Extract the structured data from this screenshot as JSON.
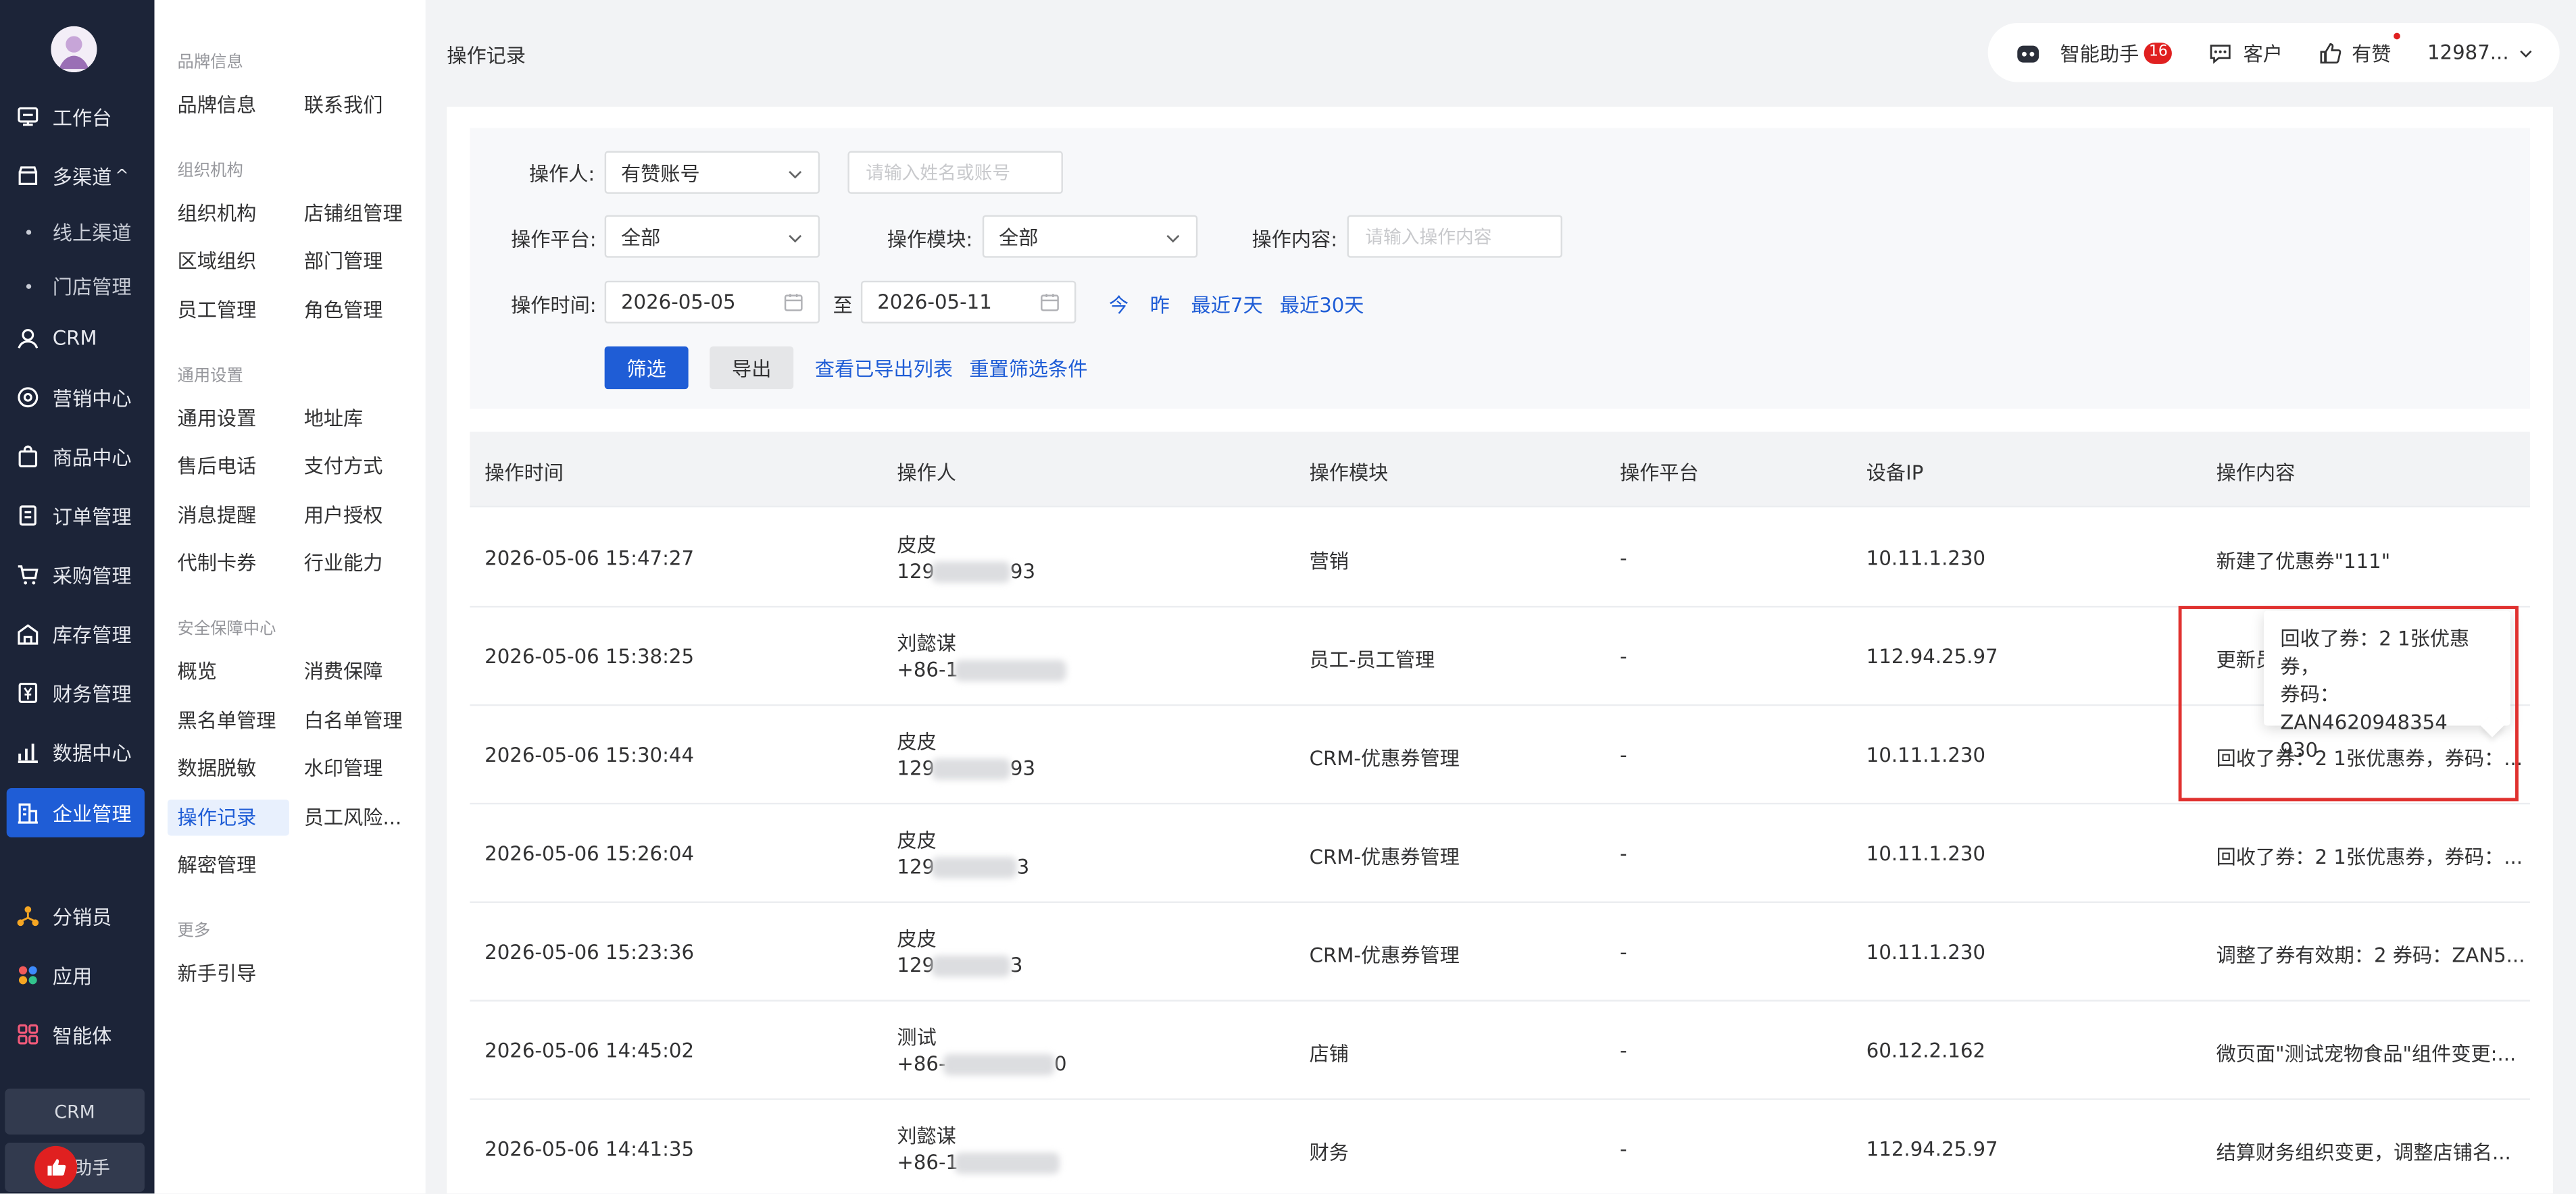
{
  "nav": {
    "items": [
      {
        "label": "工作台",
        "icon": "workbench-icon"
      },
      {
        "label": "多渠道",
        "icon": "store-icon",
        "suffix": "^"
      },
      {
        "label": "CRM",
        "icon": "user-icon"
      },
      {
        "label": "营销中心",
        "icon": "marketing-icon"
      },
      {
        "label": "商品中心",
        "icon": "bag-icon"
      },
      {
        "label": "订单管理",
        "icon": "order-icon"
      },
      {
        "label": "采购管理",
        "icon": "cart-icon"
      },
      {
        "label": "库存管理",
        "icon": "warehouse-icon"
      },
      {
        "label": "财务管理",
        "icon": "finance-icon"
      },
      {
        "label": "数据中心",
        "icon": "chart-icon"
      },
      {
        "label": "企业管理",
        "icon": "enterprise-icon"
      },
      {
        "label": "分销员",
        "icon": "distributor-icon"
      },
      {
        "label": "应用",
        "icon": "apps-icon"
      },
      {
        "label": "智能体",
        "icon": "agent-icon"
      }
    ],
    "sub_items": [
      "线上渠道",
      "门店管理"
    ],
    "crm_button": "CRM",
    "help_button": "助手"
  },
  "menu2": {
    "sections": [
      "品牌信息",
      "组织机构",
      "通用设置",
      "安全保障中心",
      "更多"
    ],
    "links": [
      "品牌信息",
      "联系我们",
      "组织机构",
      "店铺组管理",
      "区域组织",
      "部门管理",
      "员工管理",
      "角色管理",
      "通用设置",
      "地址库",
      "售后电话",
      "支付方式",
      "消息提醒",
      "用户授权",
      "代制卡券",
      "行业能力",
      "概览",
      "消费保障",
      "黑名单管理",
      "白名单管理",
      "数据脱敏",
      "水印管理",
      "操作记录",
      "员工风险...",
      "解密管理",
      "新手引导"
    ]
  },
  "header": {
    "page_title": "操作记录",
    "assistant": "智能助手",
    "assistant_badge": "16",
    "customer": "客户",
    "youzan": "有赞",
    "account": "12987..."
  },
  "filter": {
    "operator_label": "操作人:",
    "operator_type": "有赞账号",
    "operator_placeholder": "请输入姓名或账号",
    "platform_label": "操作平台:",
    "platform_value": "全部",
    "module_label": "操作模块:",
    "module_value": "全部",
    "content_label": "操作内容:",
    "content_placeholder": "请输入操作内容",
    "time_label": "操作时间:",
    "start_date": "2026-05-05",
    "to": "至",
    "end_date": "2026-05-11",
    "quick": [
      "今",
      "昨",
      "最近7天",
      "最近30天"
    ],
    "filter_button": "筛选",
    "export_button": "导出",
    "view_exports": "查看已导出列表",
    "reset": "重置筛选条件"
  },
  "table": {
    "columns": [
      "操作时间",
      "操作人",
      "操作模块",
      "操作平台",
      "设备IP",
      "操作内容"
    ],
    "rows": [
      {
        "time": "2026-05-06 15:47:27",
        "name": "皮皮",
        "account": "129",
        "account_tail": "93",
        "module": "营销",
        "platform": "-",
        "ip": "10.11.1.230",
        "content": "新建了优惠券\"111\""
      },
      {
        "time": "2026-05-06 15:38:25",
        "name": "刘懿谋",
        "account": "+86-1",
        "account_tail": "",
        "module": "员工-员工管理",
        "platform": "-",
        "ip": "112.94.25.97",
        "content": "更新员"
      },
      {
        "time": "2026-05-06 15:30:44",
        "name": "皮皮",
        "account": "129",
        "account_tail": "93",
        "module": "CRM-优惠券管理",
        "platform": "-",
        "ip": "10.11.1.230",
        "content": "回收了券：2 1张优惠券，券码：..."
      },
      {
        "time": "2026-05-06 15:26:04",
        "name": "皮皮",
        "account": "129",
        "account_tail": "3",
        "module": "CRM-优惠券管理",
        "platform": "-",
        "ip": "10.11.1.230",
        "content": "回收了券：2 1张优惠券，券码：..."
      },
      {
        "time": "2026-05-06 15:23:36",
        "name": "皮皮",
        "account": "129",
        "account_tail": "3",
        "module": "CRM-优惠券管理",
        "platform": "-",
        "ip": "10.11.1.230",
        "content": "调整了券有效期：2 券码：ZAN5..."
      },
      {
        "time": "2026-05-06 14:45:02",
        "name": "测试",
        "account": "+86-",
        "account_tail": "0",
        "module": "店铺",
        "platform": "-",
        "ip": "60.12.2.162",
        "content": "微页面\"测试宠物食品\"组件变更:..."
      },
      {
        "time": "2026-05-06 14:41:35",
        "name": "刘懿谋",
        "account": "+86-1",
        "account_tail": "",
        "module": "财务",
        "platform": "-",
        "ip": "112.94.25.97",
        "content": "结算财务组织变更，调整店铺名..."
      }
    ]
  },
  "tooltip": {
    "line1": "回收了券：2 1张优惠券，",
    "line2": "券码：ZAN4620948354",
    "line3": "930"
  },
  "colors": {
    "accent": "#1f5dd6",
    "nav_bg": "#1c2438",
    "highlight": "#e0312f",
    "badge": "#e02020"
  }
}
